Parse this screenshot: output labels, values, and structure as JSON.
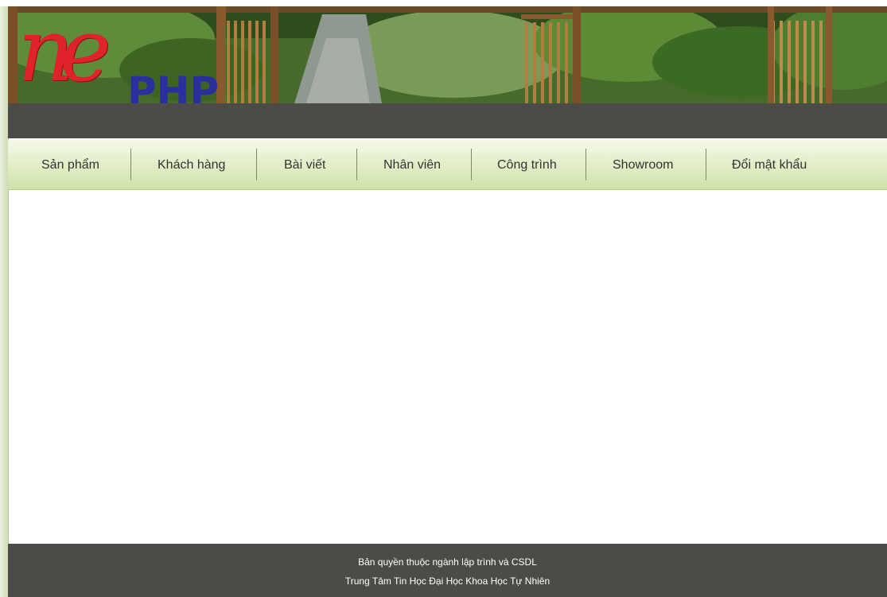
{
  "logo": {
    "script_text": "ne",
    "brand_text": "PHP"
  },
  "nav": {
    "items": [
      {
        "label": "Sản phẩm"
      },
      {
        "label": "Khách hàng"
      },
      {
        "label": "Bài viết"
      },
      {
        "label": "Nhân viên"
      },
      {
        "label": "Công trình"
      },
      {
        "label": "Showroom"
      },
      {
        "label": "Đổi mật khẩu"
      }
    ]
  },
  "footer": {
    "line1": "Bản quyền thuộc ngành lập trình và CSDL",
    "line2": "Trung Tâm Tin Học Đại Học Khoa Học Tự Nhiên"
  },
  "colors": {
    "dark_bar": "#4b4c47",
    "nav_gradient_top": "#f4f9e8",
    "nav_gradient_bottom": "#cfe2a8",
    "logo_red": "#e0222a",
    "logo_blue": "#2b2f9c"
  }
}
